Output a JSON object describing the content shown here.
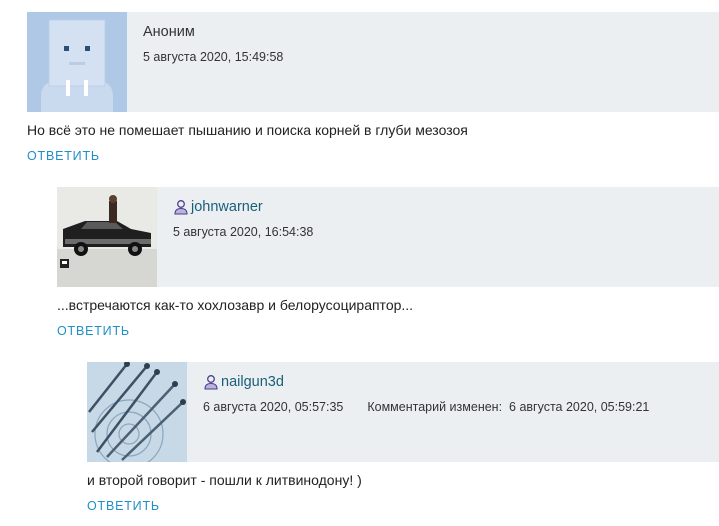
{
  "comments": [
    {
      "author": "Аноним",
      "date": "5 августа 2020, 15:49:58",
      "text": "Но всё это не помешает пышанию и поиска корней в глуби мезозоя",
      "reply_label": "ОТВЕТИТЬ"
    },
    {
      "author": "johnwarner",
      "date": "5 августа 2020, 16:54:38",
      "text": "...встречаются как-то хохлозавр и белорусоцираптор...",
      "reply_label": "ОТВЕТИТЬ"
    },
    {
      "author": "nailgun3d",
      "date": "6 августа 2020, 05:57:35",
      "edited_label": "Комментарий изменен:",
      "edited_date": "6 августа 2020, 05:59:21",
      "text": "и второй говорит - пошли к литвинодону! )",
      "reply_label": "ОТВЕТИТЬ"
    }
  ],
  "icons": {
    "user": "user-icon",
    "accent_color": "#1f8fc6",
    "link_color": "#1a5f7a",
    "header_bg": "#eceff1"
  }
}
